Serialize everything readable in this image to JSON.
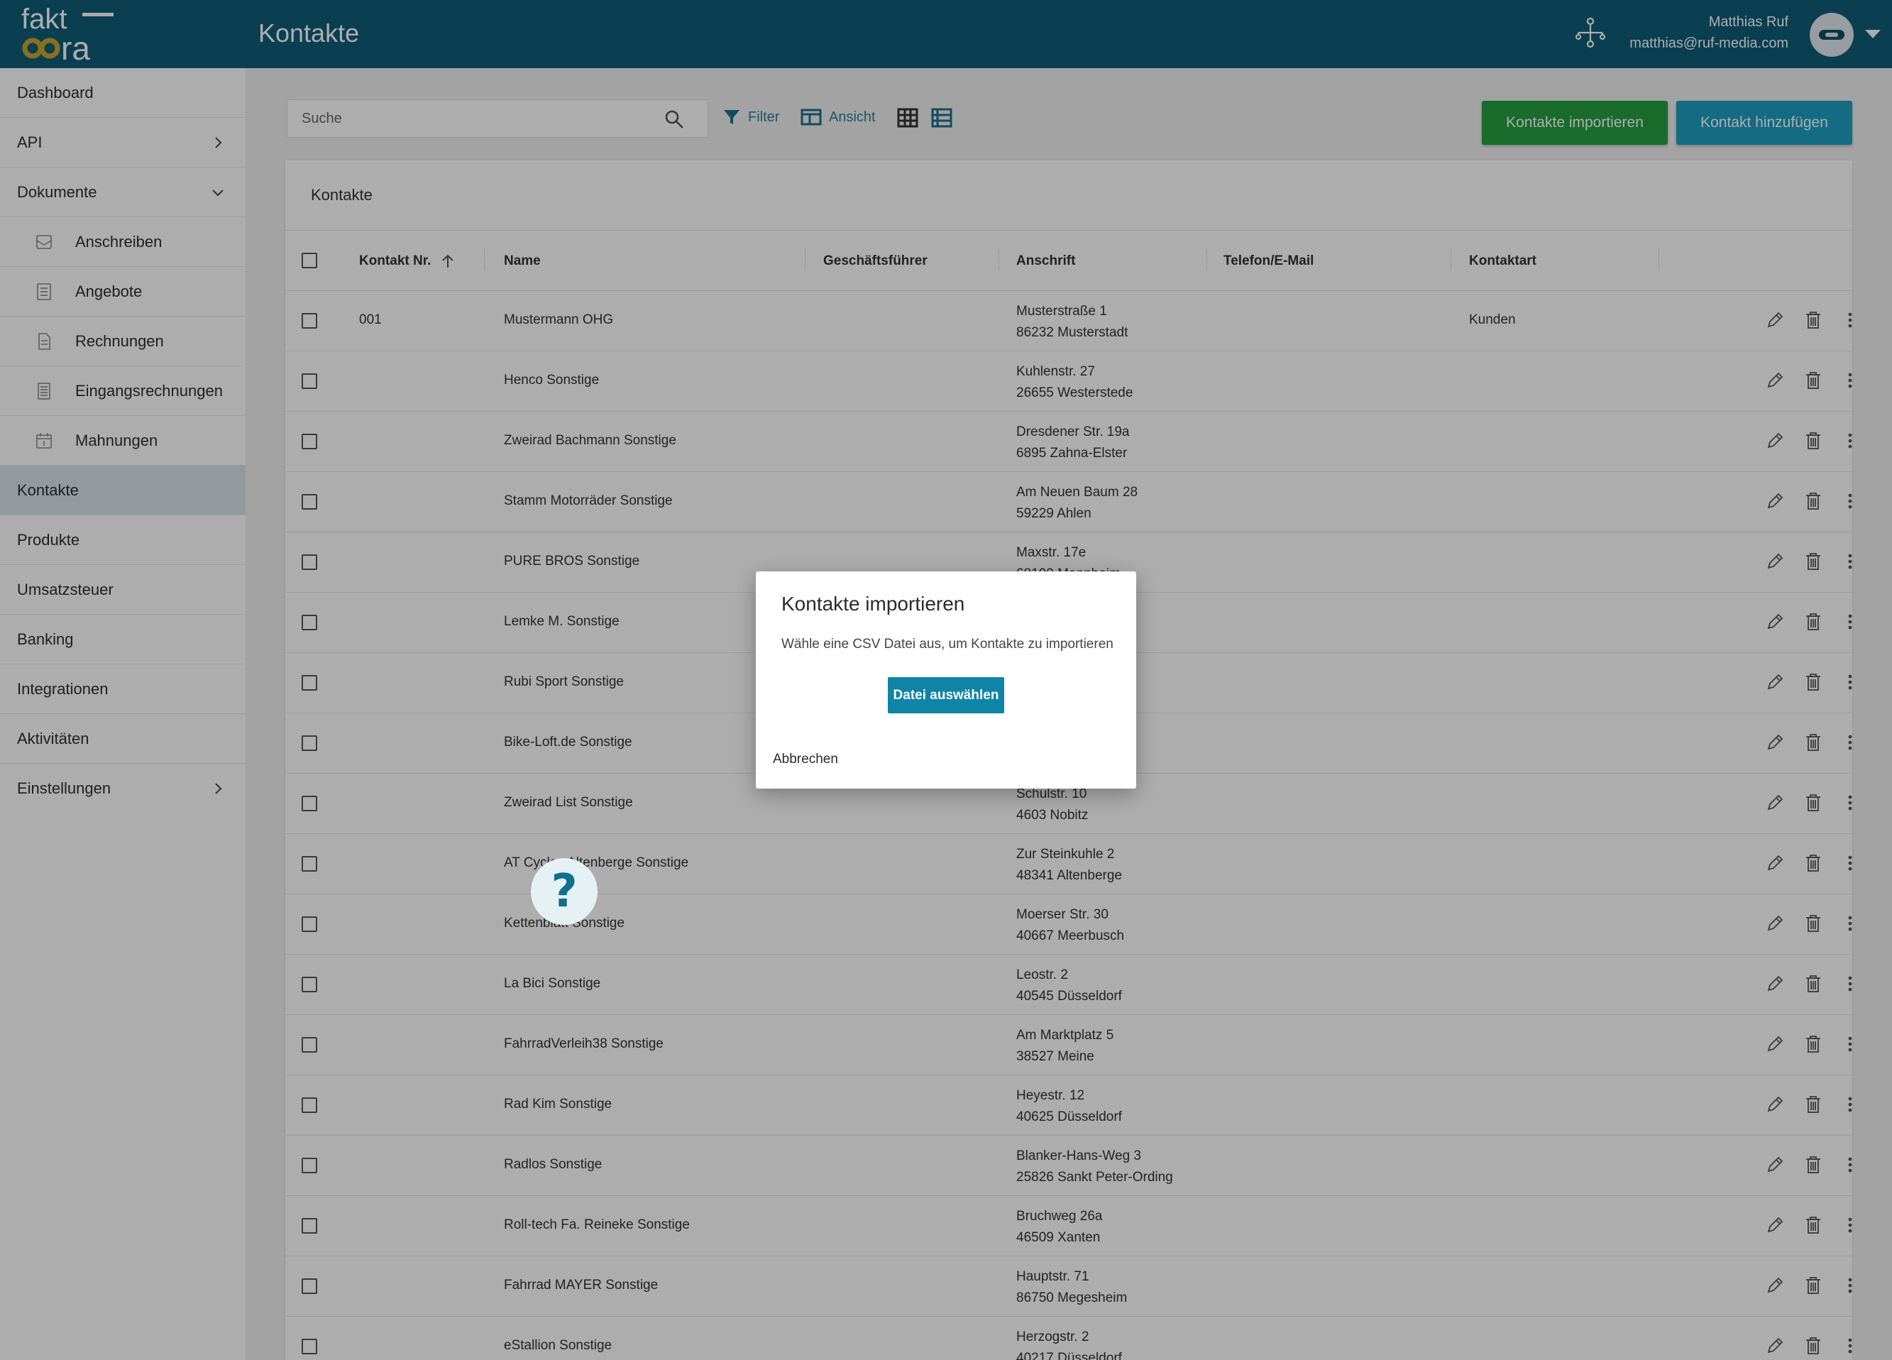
{
  "header": {
    "title": "Kontakte",
    "user_name": "Matthias Ruf",
    "user_email": "matthias@ruf-media.com",
    "logo_text_top": "fakt",
    "logo_text_bottom": "ra",
    "brand_color": "#0f5e78"
  },
  "sidebar": {
    "items": [
      {
        "label": "Dashboard"
      },
      {
        "label": "API"
      },
      {
        "label": "Dokumente"
      },
      {
        "label": "Anschreiben"
      },
      {
        "label": "Angebote"
      },
      {
        "label": "Rechnungen"
      },
      {
        "label": "Eingangsrechnungen"
      },
      {
        "label": "Mahnungen"
      },
      {
        "label": "Kontakte"
      },
      {
        "label": "Produkte"
      },
      {
        "label": "Umsatzsteuer"
      },
      {
        "label": "Banking"
      },
      {
        "label": "Integrationen"
      },
      {
        "label": "Aktivitäten"
      },
      {
        "label": "Einstellungen"
      }
    ]
  },
  "toolbar": {
    "search_placeholder": "Suche",
    "filter_label": "Filter",
    "view_label": "Ansicht",
    "import_label": "Kontakte importieren",
    "add_label": "Kontakt hinzufügen",
    "import_color": "#26a040",
    "add_color": "#1d9fc2"
  },
  "table": {
    "card_title": "Kontakte",
    "headers": [
      "Kontakt Nr.",
      "Name",
      "Geschäftsführer",
      "Anschrift",
      "Telefon/E-Mail",
      "Kontaktart"
    ],
    "rows": [
      {
        "nr": "001",
        "name": "Mustermann OHG",
        "street": "Musterstraße 1",
        "city": "86232 Musterstadt",
        "type": "Kunden"
      },
      {
        "nr": "",
        "name": "Henco Sonstige",
        "street": "Kuhlenstr. 27",
        "city": "26655 Westerstede",
        "type": ""
      },
      {
        "nr": "",
        "name": "Zweirad Bachmann Sonstige",
        "street": "Dresdener Str. 19a",
        "city": "6895 Zahna-Elster",
        "type": ""
      },
      {
        "nr": "",
        "name": "Stamm Motorräder Sonstige",
        "street": "Am Neuen Baum 28",
        "city": "59229 Ahlen",
        "type": ""
      },
      {
        "nr": "",
        "name": "PURE BROS Sonstige",
        "street": "Maxstr. 17e",
        "city": "68199 Mannheim",
        "type": ""
      },
      {
        "nr": "",
        "name": "Lemke M. Sonstige",
        "street": "",
        "city": "",
        "type": ""
      },
      {
        "nr": "",
        "name": "Rubi Sport Sonstige",
        "street": "",
        "city": "",
        "type": ""
      },
      {
        "nr": "",
        "name": "Bike-Loft.de Sonstige",
        "street": "",
        "city": "",
        "type": ""
      },
      {
        "nr": "",
        "name": "Zweirad List Sonstige",
        "street": "Schulstr. 10",
        "city": "4603 Nobitz",
        "type": ""
      },
      {
        "nr": "",
        "name": "AT Cycles Altenberge Sonstige",
        "street": "Zur Steinkuhle 2",
        "city": "48341 Altenberge",
        "type": ""
      },
      {
        "nr": "",
        "name": "Kettenblatt Sonstige",
        "street": "Moerser Str. 30",
        "city": "40667 Meerbusch",
        "type": ""
      },
      {
        "nr": "",
        "name": "La Bici Sonstige",
        "street": "Leostr. 2",
        "city": "40545 Düsseldorf",
        "type": ""
      },
      {
        "nr": "",
        "name": "FahrradVerleih38 Sonstige",
        "street": "Am Marktplatz 5",
        "city": "38527 Meine",
        "type": ""
      },
      {
        "nr": "",
        "name": "Rad Kim Sonstige",
        "street": "Heyestr. 12",
        "city": "40625 Düsseldorf",
        "type": ""
      },
      {
        "nr": "",
        "name": "Radlos Sonstige",
        "street": "Blanker-Hans-Weg 3",
        "city": "25826 Sankt Peter-Ording",
        "type": ""
      },
      {
        "nr": "",
        "name": "Roll-tech Fa. Reineke Sonstige",
        "street": "Bruchweg 26a",
        "city": "46509 Xanten",
        "type": ""
      },
      {
        "nr": "",
        "name": "Fahrrad MAYER Sonstige",
        "street": "Hauptstr. 71",
        "city": "86750 Megesheim",
        "type": ""
      },
      {
        "nr": "",
        "name": "eStallion Sonstige",
        "street": "Herzogstr. 2",
        "city": "40217 Düsseldorf",
        "type": ""
      }
    ]
  },
  "dialog": {
    "title": "Kontakte importieren",
    "text": "Wähle eine CSV Datei aus, um Kontakte zu importieren",
    "choose_label": "Datei auswählen",
    "cancel_label": "Abbrechen"
  },
  "help": {
    "glyph": "?"
  }
}
